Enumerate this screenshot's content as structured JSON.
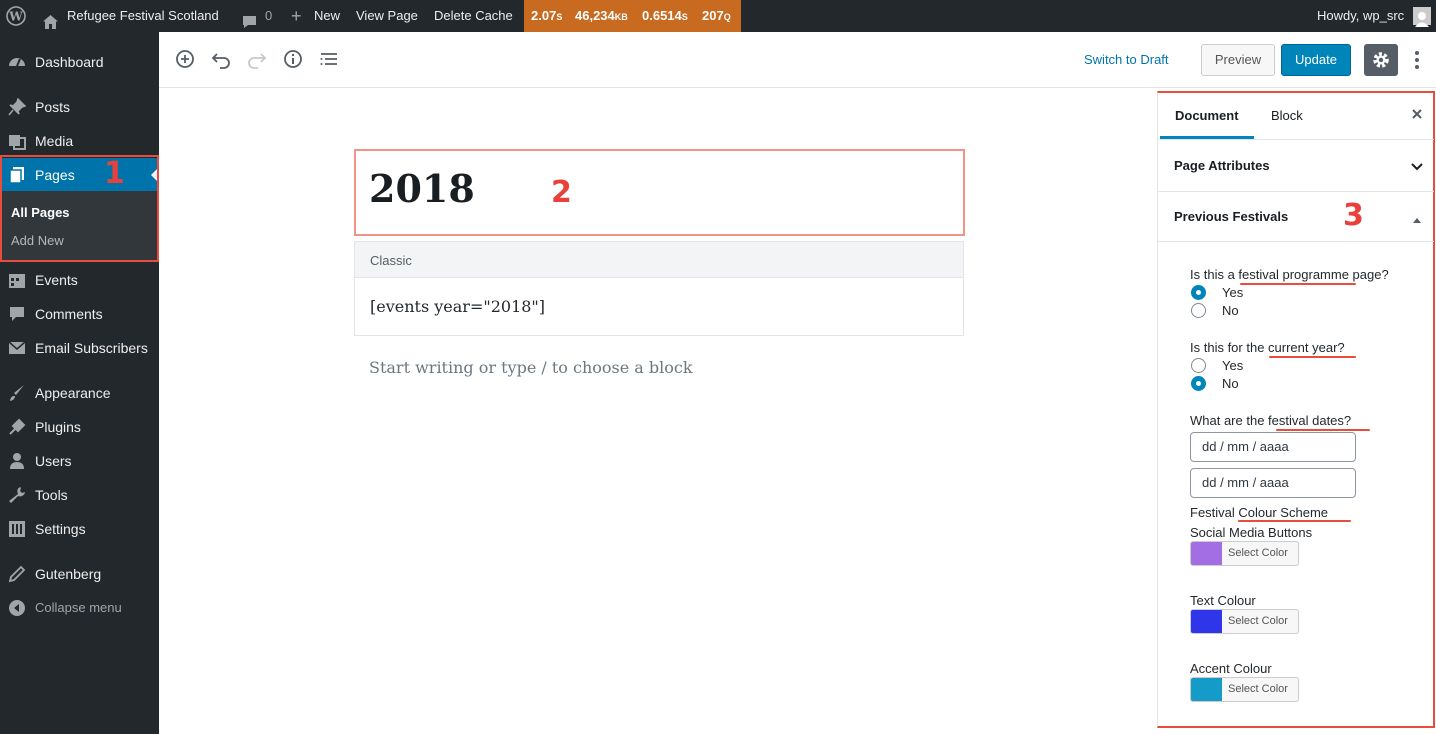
{
  "adminbar": {
    "site_name": "Refugee Festival Scotland",
    "comments_count": "0",
    "new_label": "New",
    "view_page": "View Page",
    "delete_cache": "Delete Cache",
    "perf": {
      "time": "2.07",
      "time_unit": "S",
      "memory": "46,234",
      "memory_unit": "KB",
      "query_time": "0.6514",
      "query_time_unit": "S",
      "queries": "207",
      "queries_unit": "Q"
    },
    "howdy": "Howdy, wp_src"
  },
  "sidebar_menu": {
    "items": [
      {
        "label": "Dashboard",
        "icon": "dashboard-icon"
      },
      {
        "label": "Posts",
        "icon": "pin-icon"
      },
      {
        "label": "Media",
        "icon": "media-icon"
      },
      {
        "label": "Pages",
        "icon": "pages-icon"
      },
      {
        "label": "Events",
        "icon": "events-icon"
      },
      {
        "label": "Comments",
        "icon": "comment-icon"
      },
      {
        "label": "Email Subscribers",
        "icon": "envelope-icon"
      },
      {
        "label": "Appearance",
        "icon": "brush-icon"
      },
      {
        "label": "Plugins",
        "icon": "plug-icon"
      },
      {
        "label": "Users",
        "icon": "user-icon"
      },
      {
        "label": "Tools",
        "icon": "wrench-icon"
      },
      {
        "label": "Settings",
        "icon": "settings-icon"
      },
      {
        "label": "Gutenberg",
        "icon": "pencil-icon"
      },
      {
        "label": "Collapse menu",
        "icon": "collapse-icon"
      }
    ],
    "submenu": [
      "All Pages",
      "Add New"
    ]
  },
  "annotations": [
    "1",
    "2",
    "3"
  ],
  "editor": {
    "switch_to_draft": "Switch to Draft",
    "preview": "Preview",
    "update": "Update",
    "title": "2018",
    "classic_label": "Classic",
    "classic_content": "[events year=\"2018\"]",
    "placeholder": "Start writing or type / to choose a block"
  },
  "settings_sidebar": {
    "tabs": [
      "Document",
      "Block"
    ],
    "page_attributes": "Page Attributes",
    "previous_festivals": "Previous Festivals",
    "q_programme": "Is this a festival programme page?",
    "q_current_year": "Is this for the current year?",
    "q_dates": "What are the festival dates?",
    "yes": "Yes",
    "no": "No",
    "date_placeholder": "dd / mm / aaaa",
    "colour_scheme": "Festival Colour Scheme",
    "social_buttons": "Social Media Buttons",
    "text_colour": "Text Colour",
    "accent_colour": "Accent Colour",
    "select_color": "Select Color",
    "colors": {
      "social": "#a36ee3",
      "text": "#2f35e8",
      "accent": "#159bc7"
    }
  },
  "colors": {
    "accent": "#0085ba",
    "admin_dark": "#23282d",
    "annotation": "#e74c3c"
  }
}
